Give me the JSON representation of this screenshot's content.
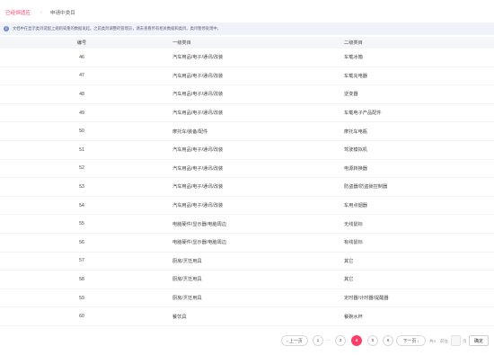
{
  "breadcrumb": {
    "parent": "已经恒适应",
    "separator": "›",
    "current": "申请中类目"
  },
  "notice": {
    "icon": "info-icon",
    "text": "文档中在显示类目适配上规则或重的数据发起。之前类目调整的管理员，请去查看所有相关数据和类目。类目暂停处理中。"
  },
  "table": {
    "headers": {
      "id": "编号",
      "level1": "一级类目",
      "level2": "二级类目"
    },
    "rows": [
      {
        "id": "46",
        "level1": "汽车用品/电子/通讯/改装",
        "level2": "车载冰箱"
      },
      {
        "id": "47",
        "level1": "汽车用品/电子/通讯/改装",
        "level2": "车载充电器"
      },
      {
        "id": "48",
        "level1": "汽车用品/电子/通讯/改装",
        "level2": "逆变器"
      },
      {
        "id": "49",
        "level1": "汽车用品/电子/通讯/改装",
        "level2": "车载电子产品配件"
      },
      {
        "id": "50",
        "level1": "摩托车/装备/配件",
        "level2": "摩托车电瓶"
      },
      {
        "id": "51",
        "level1": "汽车用品/电子/通讯/改装",
        "level2": "驾驶模拟机"
      },
      {
        "id": "52",
        "level1": "汽车用品/电子/通讯/改装",
        "level2": "电源转换器"
      },
      {
        "id": "53",
        "level1": "汽车用品/电子/通讯/改装",
        "level2": "防盗器/防盗锁控制器"
      },
      {
        "id": "54",
        "level1": "汽车用品/电子/通讯/改装",
        "level2": "车用点烟器"
      },
      {
        "id": "55",
        "level1": "电脑硬件/显示器/电脑周边",
        "level2": "无线鼠标"
      },
      {
        "id": "56",
        "level1": "电脑硬件/显示器/电脑周边",
        "level2": "有线鼠标"
      },
      {
        "id": "57",
        "level1": "厨房/烹饪用具",
        "level2": "其它"
      },
      {
        "id": "58",
        "level1": "厨房/烹饪用具",
        "level2": "其它"
      },
      {
        "id": "59",
        "level1": "厨房/烹饪用具",
        "level2": "定时器/计时器/提醒器"
      },
      {
        "id": "60",
        "level1": "餐饮具",
        "level2": "餐碗水杯"
      }
    ]
  },
  "pagination": {
    "prev": "‹ 上一页",
    "next": "下一页 ›",
    "pages": [
      "1",
      "3",
      "4",
      "5",
      "6"
    ],
    "ellipsis": "···",
    "current": "4",
    "total_text": "共4",
    "goto_prefix": "前往",
    "goto_suffix": "页",
    "go_button": "确定",
    "colors": {
      "accent": "#ff3d6b"
    }
  }
}
